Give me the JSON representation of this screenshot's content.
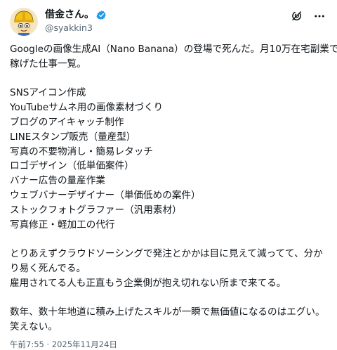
{
  "author": {
    "display_name": "借金さん。",
    "handle": "@syakkin3"
  },
  "colors": {
    "verified": "#1d9bf0",
    "text": "#0f1419",
    "secondary": "#536471"
  },
  "icons": {
    "verified": "verified-badge-icon",
    "grok": "grok-icon",
    "more": "more-options-icon"
  },
  "tweet": {
    "lines": [
      "Googleの画像生成AI（Nano Banana）の登場で死んだ。月10万在宅副業で",
      "稼げた仕事一覧。",
      "",
      "SNSアイコン作成",
      "YouTubeサムネ用の画像素材づくり",
      "ブログのアイキャッチ制作",
      "LINEスタンプ販売（量産型）",
      "写真の不要物消し・簡易レタッチ",
      "ロゴデザイン（低単価案件）",
      "バナー広告の量産作業",
      "ウェブバナーデザイナー（単価低めの案件）",
      "ストックフォトグラファー（汎用素材）",
      "写真修正・軽加工の代行",
      "",
      "とりあえずクラウドソーシングで発注とかかは目に見えて減ってて、分か",
      "り易く死んでる。",
      "雇用されてる人も正直もう企業側が抱え切れない所まで来てる。",
      "",
      "数年、数十年地道に積み上げたスキルが一瞬で無価値になるのはエグい。",
      "笑えない。"
    ],
    "timestamp": "午前7:55 · 2025年11月24日"
  }
}
